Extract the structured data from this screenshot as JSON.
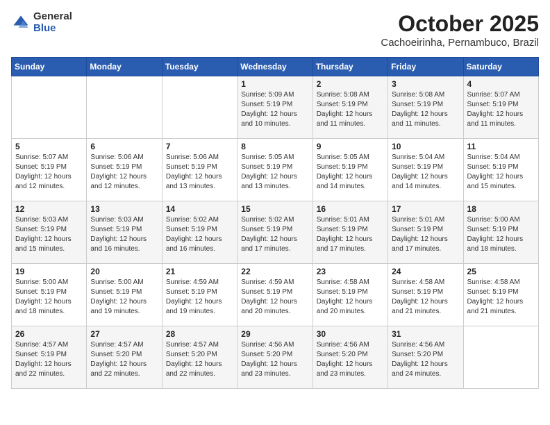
{
  "logo": {
    "general": "General",
    "blue": "Blue"
  },
  "title": "October 2025",
  "location": "Cachoeirinha, Pernambuco, Brazil",
  "days_of_week": [
    "Sunday",
    "Monday",
    "Tuesday",
    "Wednesday",
    "Thursday",
    "Friday",
    "Saturday"
  ],
  "weeks": [
    [
      {
        "day": "",
        "info": ""
      },
      {
        "day": "",
        "info": ""
      },
      {
        "day": "",
        "info": ""
      },
      {
        "day": "1",
        "info": "Sunrise: 5:09 AM\nSunset: 5:19 PM\nDaylight: 12 hours\nand 10 minutes."
      },
      {
        "day": "2",
        "info": "Sunrise: 5:08 AM\nSunset: 5:19 PM\nDaylight: 12 hours\nand 11 minutes."
      },
      {
        "day": "3",
        "info": "Sunrise: 5:08 AM\nSunset: 5:19 PM\nDaylight: 12 hours\nand 11 minutes."
      },
      {
        "day": "4",
        "info": "Sunrise: 5:07 AM\nSunset: 5:19 PM\nDaylight: 12 hours\nand 11 minutes."
      }
    ],
    [
      {
        "day": "5",
        "info": "Sunrise: 5:07 AM\nSunset: 5:19 PM\nDaylight: 12 hours\nand 12 minutes."
      },
      {
        "day": "6",
        "info": "Sunrise: 5:06 AM\nSunset: 5:19 PM\nDaylight: 12 hours\nand 12 minutes."
      },
      {
        "day": "7",
        "info": "Sunrise: 5:06 AM\nSunset: 5:19 PM\nDaylight: 12 hours\nand 13 minutes."
      },
      {
        "day": "8",
        "info": "Sunrise: 5:05 AM\nSunset: 5:19 PM\nDaylight: 12 hours\nand 13 minutes."
      },
      {
        "day": "9",
        "info": "Sunrise: 5:05 AM\nSunset: 5:19 PM\nDaylight: 12 hours\nand 14 minutes."
      },
      {
        "day": "10",
        "info": "Sunrise: 5:04 AM\nSunset: 5:19 PM\nDaylight: 12 hours\nand 14 minutes."
      },
      {
        "day": "11",
        "info": "Sunrise: 5:04 AM\nSunset: 5:19 PM\nDaylight: 12 hours\nand 15 minutes."
      }
    ],
    [
      {
        "day": "12",
        "info": "Sunrise: 5:03 AM\nSunset: 5:19 PM\nDaylight: 12 hours\nand 15 minutes."
      },
      {
        "day": "13",
        "info": "Sunrise: 5:03 AM\nSunset: 5:19 PM\nDaylight: 12 hours\nand 16 minutes."
      },
      {
        "day": "14",
        "info": "Sunrise: 5:02 AM\nSunset: 5:19 PM\nDaylight: 12 hours\nand 16 minutes."
      },
      {
        "day": "15",
        "info": "Sunrise: 5:02 AM\nSunset: 5:19 PM\nDaylight: 12 hours\nand 17 minutes."
      },
      {
        "day": "16",
        "info": "Sunrise: 5:01 AM\nSunset: 5:19 PM\nDaylight: 12 hours\nand 17 minutes."
      },
      {
        "day": "17",
        "info": "Sunrise: 5:01 AM\nSunset: 5:19 PM\nDaylight: 12 hours\nand 17 minutes."
      },
      {
        "day": "18",
        "info": "Sunrise: 5:00 AM\nSunset: 5:19 PM\nDaylight: 12 hours\nand 18 minutes."
      }
    ],
    [
      {
        "day": "19",
        "info": "Sunrise: 5:00 AM\nSunset: 5:19 PM\nDaylight: 12 hours\nand 18 minutes."
      },
      {
        "day": "20",
        "info": "Sunrise: 5:00 AM\nSunset: 5:19 PM\nDaylight: 12 hours\nand 19 minutes."
      },
      {
        "day": "21",
        "info": "Sunrise: 4:59 AM\nSunset: 5:19 PM\nDaylight: 12 hours\nand 19 minutes."
      },
      {
        "day": "22",
        "info": "Sunrise: 4:59 AM\nSunset: 5:19 PM\nDaylight: 12 hours\nand 20 minutes."
      },
      {
        "day": "23",
        "info": "Sunrise: 4:58 AM\nSunset: 5:19 PM\nDaylight: 12 hours\nand 20 minutes."
      },
      {
        "day": "24",
        "info": "Sunrise: 4:58 AM\nSunset: 5:19 PM\nDaylight: 12 hours\nand 21 minutes."
      },
      {
        "day": "25",
        "info": "Sunrise: 4:58 AM\nSunset: 5:19 PM\nDaylight: 12 hours\nand 21 minutes."
      }
    ],
    [
      {
        "day": "26",
        "info": "Sunrise: 4:57 AM\nSunset: 5:19 PM\nDaylight: 12 hours\nand 22 minutes."
      },
      {
        "day": "27",
        "info": "Sunrise: 4:57 AM\nSunset: 5:20 PM\nDaylight: 12 hours\nand 22 minutes."
      },
      {
        "day": "28",
        "info": "Sunrise: 4:57 AM\nSunset: 5:20 PM\nDaylight: 12 hours\nand 22 minutes."
      },
      {
        "day": "29",
        "info": "Sunrise: 4:56 AM\nSunset: 5:20 PM\nDaylight: 12 hours\nand 23 minutes."
      },
      {
        "day": "30",
        "info": "Sunrise: 4:56 AM\nSunset: 5:20 PM\nDaylight: 12 hours\nand 23 minutes."
      },
      {
        "day": "31",
        "info": "Sunrise: 4:56 AM\nSunset: 5:20 PM\nDaylight: 12 hours\nand 24 minutes."
      },
      {
        "day": "",
        "info": ""
      }
    ]
  ]
}
